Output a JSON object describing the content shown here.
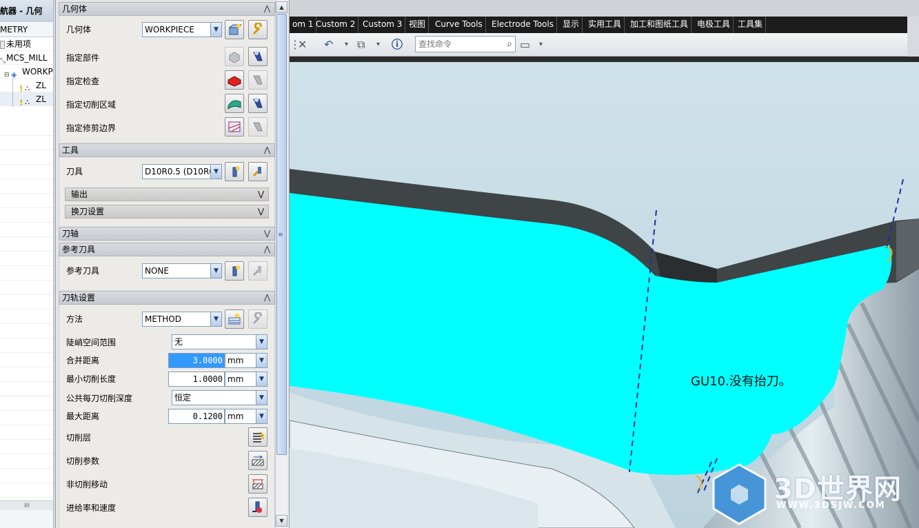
{
  "navigator": {
    "title": "导航器 - 几何",
    "header": "METRY",
    "rows": [
      {
        "label": "未用项"
      },
      {
        "label": "MCS_MILL"
      },
      {
        "label": "WORKPI"
      },
      {
        "label": "ZL"
      },
      {
        "label": "ZL"
      }
    ],
    "scroll_grip": "III"
  },
  "dialog": {
    "geometry_section": {
      "title": "几何体",
      "geometry_label": "几何体",
      "geometry_value": "WORKPIECE",
      "rows": [
        "指定部件",
        "指定检查",
        "指定切削区域",
        "指定修剪边界"
      ]
    },
    "tool_section": {
      "title": "工具",
      "tool_label": "刀具",
      "tool_value": "D10R0.5 (D10R0",
      "output_label": "输出",
      "toolchange_label": "换刀设置"
    },
    "axis_section": {
      "title": "刀轴"
    },
    "ref_tool_section": {
      "title": "参考刀具",
      "label": "参考刀具",
      "value": "NONE"
    },
    "path_section": {
      "title": "刀轨设置",
      "method_label": "方法",
      "method_value": "METHOD",
      "steep_label": "陡峭空间范围",
      "steep_value": "无",
      "merge_label": "合并距离",
      "merge_value": "3.0000",
      "merge_unit": "mm",
      "min_cut_label": "最小切削长度",
      "min_cut_value": "1.0000",
      "min_cut_unit": "mm",
      "depth_label": "公共每刀切削深度",
      "depth_value": "恒定",
      "max_dist_label": "最大距离",
      "max_dist_value": "0.1200",
      "max_dist_unit": "mm",
      "cut_levels_label": "切削层",
      "cut_params_label": "切削参数",
      "noncut_label": "非切削移动",
      "feeds_label": "进给率和速度"
    }
  },
  "menubar": [
    "om 1",
    "Custom 2",
    "Custom 3",
    "视图",
    "Curve Tools",
    "Electrode Tools",
    "显示",
    "实用工具",
    "加工和图纸工具",
    "电极工具",
    "工具集"
  ],
  "toolbar": {
    "search_placeholder": "查找命令"
  },
  "viewport": {
    "annotation": "GU10.没有抬刀。",
    "watermark": "3D世界网",
    "watermark_url": "WWW.3DSJW.COM"
  },
  "colors": {
    "cut_area": "#00ffff",
    "wall_dark": "#3c4144",
    "part_light": "#d7e3ea",
    "toolpath": "#1a2ea8",
    "menubar_bg": "#1c1c1c",
    "selection": "#3399ff"
  },
  "icons": [
    "geometry-new-icon",
    "wrench-edit-icon",
    "select-part-icon",
    "flashlight-display-icon",
    "check-geometry-icon",
    "cut-area-icon",
    "trim-boundary-icon",
    "tool-new-icon",
    "tool-edit-icon",
    "method-new-icon",
    "cut-levels-icon",
    "cut-params-icon",
    "noncut-moves-icon",
    "feeds-speeds-icon",
    "search-icon",
    "undo-icon",
    "close-icon",
    "info-icon"
  ]
}
